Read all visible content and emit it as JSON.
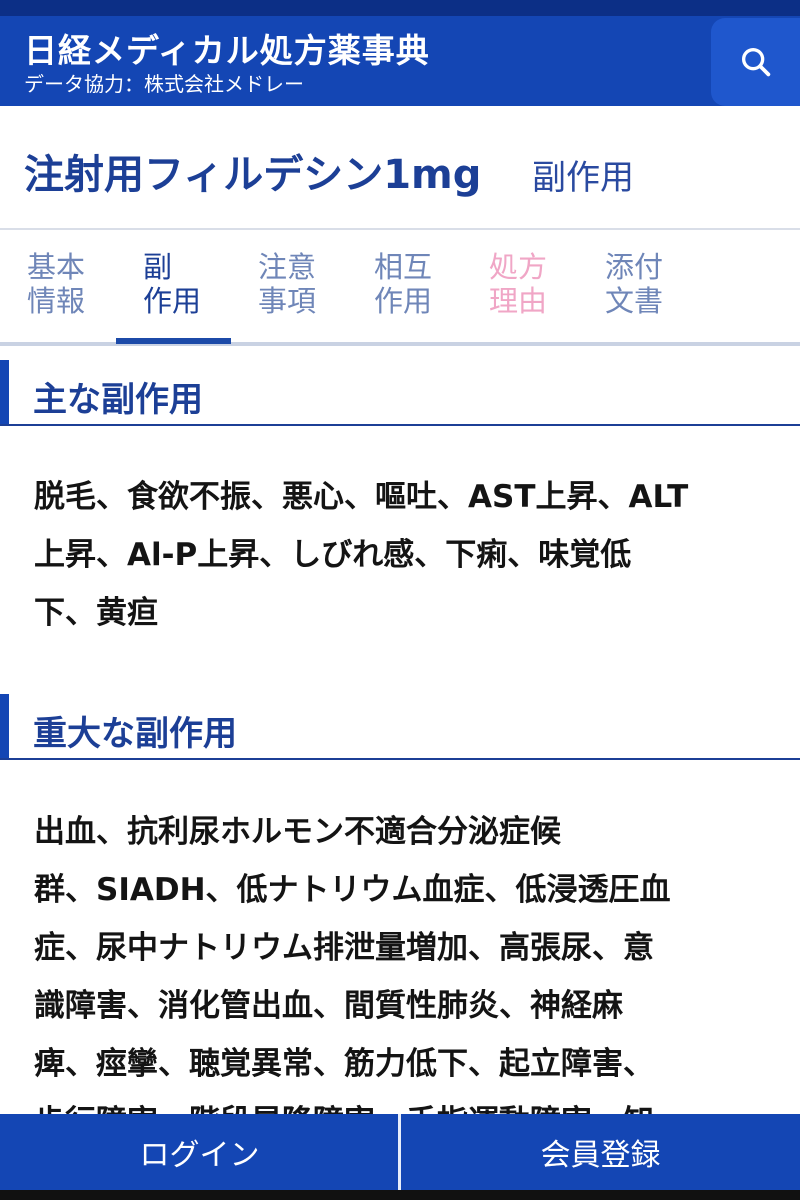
{
  "header": {
    "title": "日経メディカル処方薬事典",
    "subtitle": "データ協力：株式会社メドレー",
    "search_icon": "search-icon"
  },
  "drug": {
    "name": "注射用フィルデシン1mg",
    "section": "副作用"
  },
  "tabs": [
    {
      "line1": "基本",
      "line2": "情報",
      "state": "normal"
    },
    {
      "line1": "副",
      "line2": "作用",
      "state": "active"
    },
    {
      "line1": "注意",
      "line2": "事項",
      "state": "normal"
    },
    {
      "line1": "相互",
      "line2": "作用",
      "state": "normal"
    },
    {
      "line1": "処方",
      "line2": "理由",
      "state": "disabled"
    },
    {
      "line1": "添付",
      "line2": "文書",
      "state": "normal"
    }
  ],
  "main_side_effects": {
    "heading": "主な副作用",
    "lines": [
      "脱毛、食欲不振、悪心、嘔吐、AST上昇、ALT",
      "上昇、Al-P上昇、しびれ感、下痢、味覚低",
      "下、黄疸"
    ]
  },
  "serious_side_effects": {
    "heading": "重大な副作用",
    "lines": [
      "出血、抗利尿ホルモン不適合分泌症候",
      "群、SIADH、低ナトリウム血症、低浸透圧血",
      "症、尿中ナトリウム排泄量増加、高張尿、意",
      "識障害、消化管出血、間質性肺炎、神経麻",
      "痺、痙攣、聴覚異常、筋力低下、起立障害、",
      "歩行障害、階段昇降障害、手指運動障害、知"
    ]
  },
  "footer": {
    "login_label": "ログイン",
    "register_label": "会員登録"
  },
  "colors": {
    "brand_blue": "#1446b4",
    "heading_blue": "#1c3f96",
    "disabled_pink": "#f0a6c6"
  }
}
